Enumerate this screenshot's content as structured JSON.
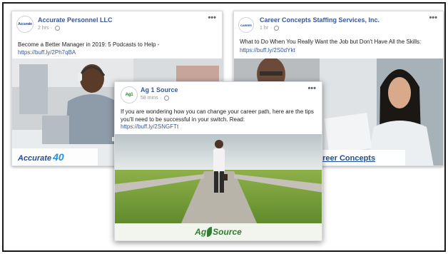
{
  "posts": [
    {
      "page_name": "Accurate Personnel LLC",
      "avatar_text": "Accurate",
      "time": "2 hrs",
      "text": "Become a Better Manager in 2019: 5 Podcasts to Help -",
      "link": "https://buff.ly/2Ph7qBA",
      "logo_text": "Accurate",
      "logo_number": "40"
    },
    {
      "page_name": "Career Concepts Staffing Services, Inc.",
      "avatar_text": "CAREER",
      "time": "1 hr",
      "text": "What to Do When You Really Want the Job but Don't Have All the Skills:",
      "link": "https://buff.ly/2S0dYkt",
      "logo_text": "areer Concepts"
    },
    {
      "page_name": "Ag 1 Source",
      "avatar_text": "Ag1",
      "time": "58 mins",
      "text": "If you are wondering how you can change your career path, here are the tips you'll need to be successful in your switch. Read:",
      "link": "https://buff.ly/2SNGFTt",
      "logo_text_left": "Ag",
      "logo_text_right": "Source"
    }
  ],
  "more_icon": "more-horizontal-icon",
  "privacy_icon": "globe-icon",
  "colors": {
    "link": "#385898",
    "page_name": "#385898",
    "meta": "#90949c",
    "ag_green": "#2f7d32"
  }
}
